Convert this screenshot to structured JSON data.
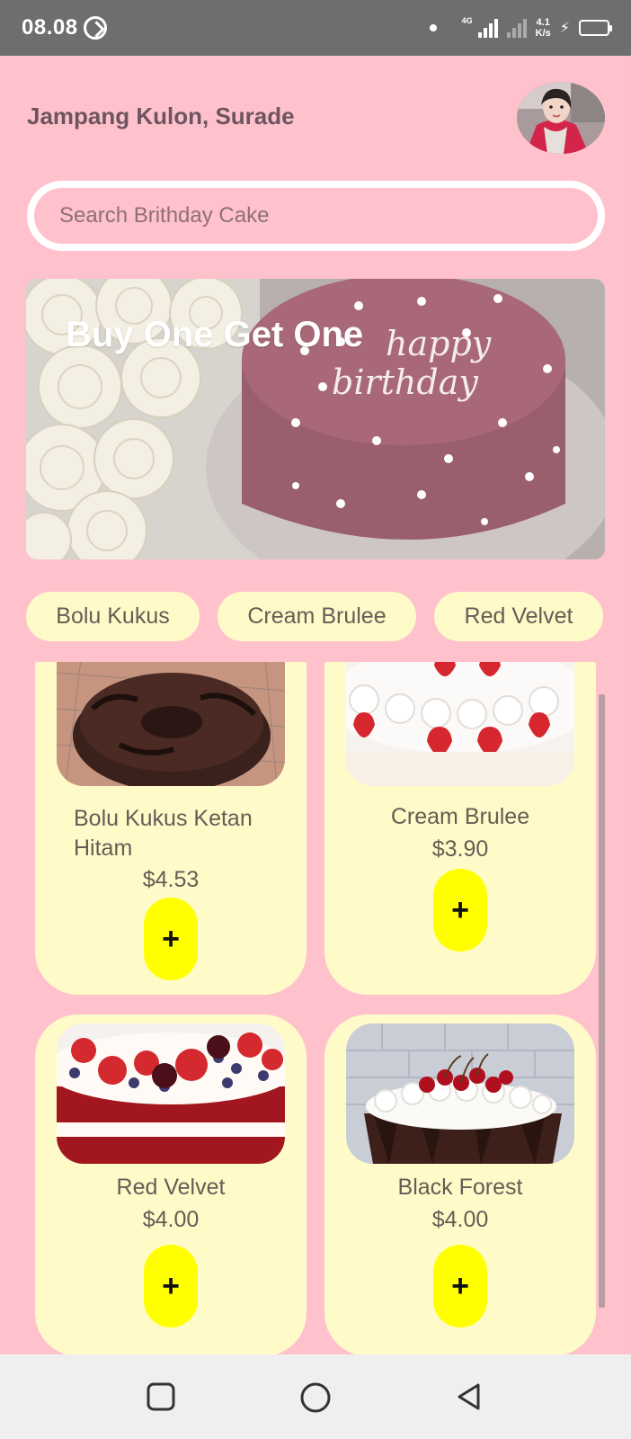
{
  "status_bar": {
    "time": "08.08",
    "network": "4G",
    "speed_value": "4.1",
    "speed_unit": "K/s"
  },
  "header": {
    "location": "Jampang Kulon, Surade"
  },
  "search": {
    "placeholder": "Search Brithday Cake"
  },
  "banner": {
    "title": "Buy One Get One",
    "cake_inscription_1": "happy",
    "cake_inscription_2": "birthday"
  },
  "categories": [
    {
      "label": "Bolu Kukus"
    },
    {
      "label": "Cream Brulee"
    },
    {
      "label": "Red Velvet"
    }
  ],
  "products": [
    {
      "name": "Bolu Kukus Ketan Hitam",
      "price": "$4.53",
      "add_label": "+"
    },
    {
      "name": "Cream Brulee",
      "price": "$3.90",
      "add_label": "+"
    },
    {
      "name": "Red Velvet",
      "price": "$4.00",
      "add_label": "+"
    },
    {
      "name": "Black Forest",
      "price": "$4.00",
      "add_label": "+"
    }
  ],
  "colors": {
    "background": "#ffc2cc",
    "card": "#fffbc9",
    "add_button": "#ffff00",
    "text": "#6b5a55"
  },
  "navigation": {
    "icons": [
      "recent-apps-icon",
      "home-icon",
      "back-icon"
    ]
  }
}
